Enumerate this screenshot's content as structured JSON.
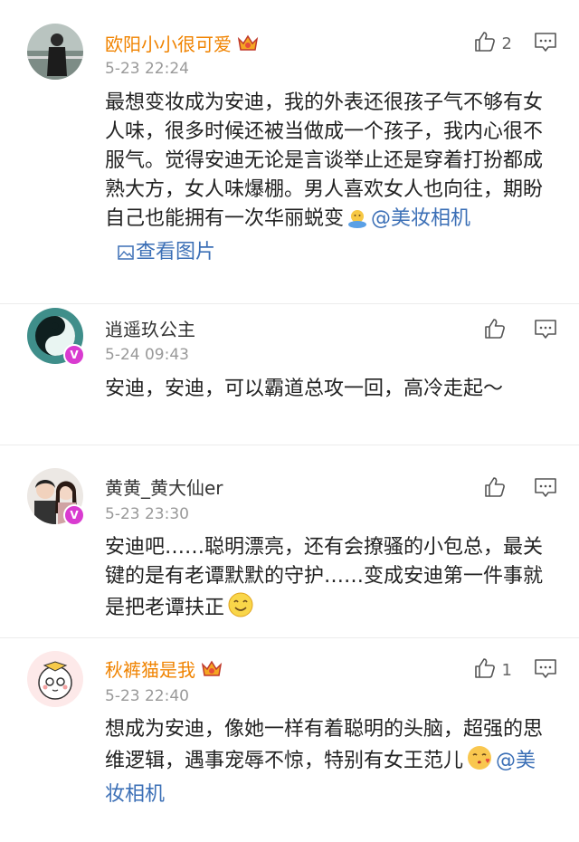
{
  "comments": [
    {
      "username": "欧阳小小很可爱",
      "timestamp": "5-23 22:24",
      "like_count": "2",
      "text": "最想变妆成为安迪，我的外表还很孩子气不够有女人味，很多时候还被当做成一个孩子，我内心很不服气。觉得安迪无论是言谈举止还是穿着打扮都成熟大方，女人味爆棚。男人喜欢女人也向往，期盼自己也能拥有一次华丽蜕变",
      "mention": "@美妆相机",
      "view_pic_label": "查看图片"
    },
    {
      "username": "逍遥玖公主",
      "timestamp": "5-24 09:43",
      "like_count": "",
      "text": "安迪，安迪，可以霸道总攻一回，高冷走起～"
    },
    {
      "username": "黄黄_黄大仙er",
      "timestamp": "5-23 23:30",
      "like_count": "",
      "text": "安迪吧……聪明漂亮，还有会撩骚的小包总，最关键的是有老谭默默的守护……变成安迪第一件事就是把老谭扶正"
    },
    {
      "username": "秋裤猫是我",
      "timestamp": "5-23 22:40",
      "like_count": "1",
      "text": "想成为安迪，像她一样有着聪明的头脑，超强的思维逻辑，遇事宠辱不惊，特别有女王范儿",
      "mention": "@美妆相机"
    }
  ],
  "colors": {
    "vip_name": "#f08300",
    "link": "#3b6fb6",
    "timestamp": "#999999",
    "verified_badge": "#d93bd0"
  },
  "icons": {
    "like": "thumbs-up-icon",
    "comment": "comment-icon",
    "vip": "crown-icon",
    "verified": "verified-v-icon",
    "picture": "picture-icon"
  }
}
